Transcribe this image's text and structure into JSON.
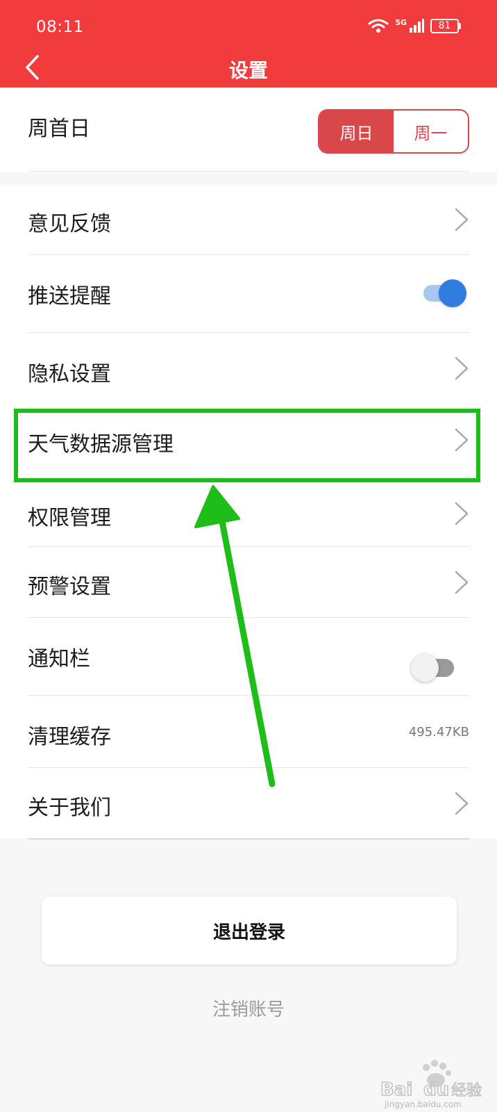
{
  "status_bar": {
    "time": "08:11",
    "battery": "81",
    "network": "5G"
  },
  "header": {
    "title": "设置"
  },
  "week_start": {
    "label": "周首日",
    "options": [
      "周日",
      "周一"
    ],
    "selected": "周日"
  },
  "menu": {
    "feedback": "意见反馈",
    "push_reminder": "推送提醒",
    "privacy_settings": "隐私设置",
    "weather_source": "天气数据源管理",
    "permissions": "权限管理",
    "alert_settings": "预警设置",
    "notification_bar": "通知栏",
    "clear_cache": "清理缓存",
    "cache_size": "495.47KB",
    "about_us": "关于我们"
  },
  "toggles": {
    "push_reminder": true,
    "notification_bar": false
  },
  "logout_label": "退出登录",
  "cancel_account_label": "注销账号",
  "watermark": {
    "text": "jingyan.baidu.com"
  },
  "colors": {
    "header": "#f23b3d",
    "accent": "#d9474a",
    "toggle_on": "#2f7de0",
    "highlight": "#1fbd1a"
  }
}
